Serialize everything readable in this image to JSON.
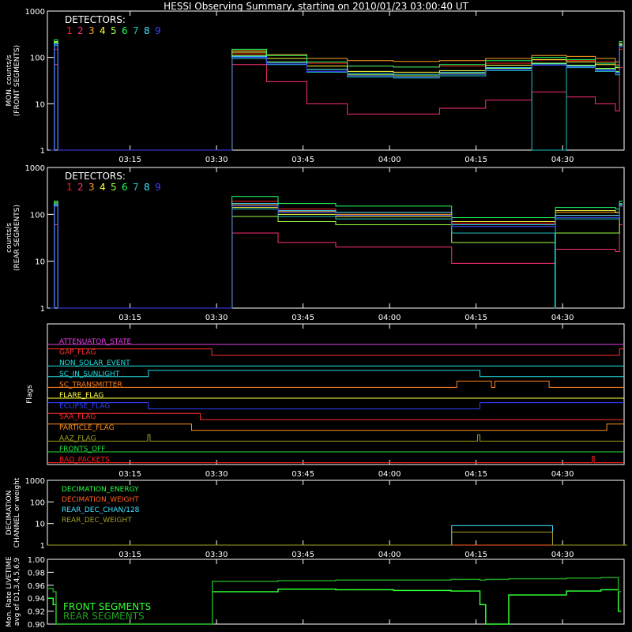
{
  "title": "HESSI Observing Summary, starting on 2010/01/23 03:00:40 UT",
  "colors": {
    "frame": "#ffffff",
    "det": [
      "#ff2020",
      "#ff3070",
      "#ffa020",
      "#ffff40",
      "#a0ff40",
      "#20ff60",
      "#20c0c0",
      "#40e0ff",
      "#4040ff"
    ]
  },
  "chart_data": [
    {
      "type": "line",
      "id": "front",
      "ylabel_lines": [
        "MON. counts/s",
        "(FRONT SEGMENTS)"
      ],
      "yscale": "log",
      "ylim": [
        1,
        1000
      ],
      "yticks": [
        "1",
        "10",
        "100",
        "1000"
      ],
      "xticks": [
        "03:15",
        "03:30",
        "03:45",
        "04:00",
        "04:15",
        "04:30"
      ],
      "legend_title": "DETECTORS:",
      "legend_items": [
        "1",
        "2",
        "3",
        "4",
        "5",
        "6",
        "7",
        "8",
        "9"
      ],
      "x_minutes": [
        0.5,
        1.2,
        1.8,
        28.5,
        32,
        38,
        45,
        52,
        60,
        68,
        76,
        84,
        90,
        95,
        98.5,
        99.2
      ],
      "series": [
        {
          "values": [
            1,
            150,
            1,
            1,
            120,
            95,
            75,
            65,
            62,
            65,
            75,
            88,
            85,
            80,
            70,
            150
          ]
        },
        {
          "values": [
            1,
            70,
            1,
            1,
            70,
            30,
            10,
            6,
            6,
            8,
            12,
            18,
            14,
            10,
            7,
            60
          ]
        },
        {
          "values": [
            1,
            200,
            1,
            1,
            140,
            115,
            95,
            85,
            82,
            85,
            95,
            110,
            105,
            95,
            80,
            180
          ]
        },
        {
          "values": [
            1,
            220,
            1,
            1,
            130,
            95,
            65,
            50,
            48,
            52,
            68,
            90,
            80,
            70,
            60,
            200
          ]
        },
        {
          "values": [
            1,
            210,
            1,
            1,
            110,
            80,
            55,
            42,
            40,
            45,
            58,
            75,
            68,
            58,
            50,
            190
          ]
        },
        {
          "values": [
            1,
            240,
            1,
            1,
            150,
            110,
            80,
            65,
            62,
            70,
            85,
            100,
            90,
            75,
            65,
            220
          ]
        },
        {
          "values": [
            1,
            180,
            1,
            1,
            95,
            70,
            48,
            38,
            36,
            40,
            52,
            1,
            60,
            50,
            42,
            170
          ]
        },
        {
          "values": [
            1,
            200,
            1,
            1,
            105,
            78,
            55,
            45,
            43,
            48,
            60,
            72,
            65,
            55,
            48,
            185
          ]
        },
        {
          "values": [
            1,
            190,
            1,
            1,
            100,
            72,
            50,
            40,
            38,
            43,
            55,
            68,
            62,
            52,
            45,
            175
          ]
        }
      ]
    },
    {
      "type": "line",
      "id": "rear",
      "ylabel_lines": [
        "counts/s",
        "(REAR SEGMENTS)"
      ],
      "yscale": "log",
      "ylim": [
        1,
        1000
      ],
      "yticks": [
        "1",
        "10",
        "100",
        "1000"
      ],
      "xticks": [
        "03:15",
        "03:30",
        "03:45",
        "04:00",
        "04:15",
        "04:30"
      ],
      "legend_title": "DETECTORS:",
      "legend_items": [
        "1",
        "2",
        "3",
        "4",
        "5",
        "6",
        "7",
        "8",
        "9"
      ],
      "x_minutes": [
        0.5,
        1.2,
        1.8,
        28.5,
        32,
        40,
        50,
        70,
        70.1,
        88,
        88.1,
        98.5,
        99.2
      ],
      "series": [
        {
          "values": [
            1,
            150,
            1,
            1,
            190,
            130,
            110,
            110,
            65,
            65,
            95,
            95,
            150
          ]
        },
        {
          "values": [
            1,
            60,
            1,
            1,
            40,
            25,
            20,
            20,
            9,
            8,
            18,
            16,
            60
          ]
        },
        {
          "values": [
            1,
            180,
            1,
            1,
            160,
            115,
            100,
            100,
            70,
            65,
            110,
            110,
            170
          ]
        },
        {
          "values": [
            1,
            150,
            1,
            1,
            140,
            100,
            90,
            90,
            70,
            70,
            120,
            110,
            160
          ]
        },
        {
          "values": [
            1,
            160,
            1,
            1,
            90,
            70,
            60,
            60,
            25,
            25,
            40,
            40,
            150
          ]
        },
        {
          "values": [
            1,
            190,
            1,
            1,
            240,
            170,
            150,
            150,
            85,
            80,
            140,
            130,
            190
          ]
        },
        {
          "values": [
            1,
            170,
            1,
            1,
            130,
            90,
            80,
            80,
            40,
            1,
            80,
            80,
            170
          ]
        },
        {
          "values": [
            1,
            160,
            1,
            1,
            170,
            120,
            110,
            110,
            60,
            60,
            95,
            95,
            160
          ]
        },
        {
          "values": [
            1,
            150,
            1,
            1,
            150,
            110,
            95,
            95,
            55,
            55,
            85,
            85,
            150
          ]
        }
      ]
    },
    {
      "type": "flags",
      "id": "flags",
      "ylabel": "Flags",
      "xticks": [
        "03:15",
        "03:30",
        "03:45",
        "04:00",
        "04:15",
        "04:30"
      ],
      "flags": [
        {
          "label": "ATTENUATOR_STATE",
          "color": "#e040e0",
          "segments": [
            [
              0,
              100,
              0
            ]
          ]
        },
        {
          "label": "GAP_FLAG",
          "color": "#ff3030",
          "segments": [
            [
              0,
              28.5,
              1
            ],
            [
              28.5,
              99.2,
              0
            ],
            [
              99.2,
              100,
              1
            ]
          ]
        },
        {
          "label": "NON_SOLAR_EVENT",
          "color": "#20e0e0",
          "segments": [
            [
              0,
              100,
              0
            ]
          ]
        },
        {
          "label": "SC_IN_SUNLIGHT",
          "color": "#20e0e0",
          "segments": [
            [
              0,
              17.5,
              0
            ],
            [
              17.5,
              75,
              1
            ],
            [
              75,
              100,
              0
            ]
          ]
        },
        {
          "label": "SC_TRANSMITTER",
          "color": "#ff8020",
          "segments": [
            [
              0,
              71,
              0
            ],
            [
              71,
              77,
              1
            ],
            [
              77,
              77.6,
              0
            ],
            [
              77.6,
              87,
              1
            ],
            [
              87,
              100,
              0
            ]
          ]
        },
        {
          "label": "FLARE_FLAG",
          "color": "#ffff40",
          "segments": [
            [
              0,
              100,
              0
            ]
          ]
        },
        {
          "label": "ECLIPSE_FLAG",
          "color": "#3040ff",
          "segments": [
            [
              0,
              17.5,
              1
            ],
            [
              17.5,
              75,
              0
            ],
            [
              75,
              100,
              1
            ]
          ]
        },
        {
          "label": "SAA_FLAG",
          "color": "#ff3030",
          "segments": [
            [
              0,
              26.5,
              1
            ],
            [
              26.5,
              100,
              0
            ]
          ]
        },
        {
          "label": "PARTICLE_FLAG",
          "color": "#ff9020",
          "segments": [
            [
              0,
              25,
              1
            ],
            [
              25,
              97,
              0
            ],
            [
              97,
              100,
              1
            ]
          ]
        },
        {
          "label": "AAZ_FLAG",
          "color": "#a0a020",
          "segments": [
            [
              0,
              17.4,
              0
            ],
            [
              17.4,
              17.8,
              1
            ],
            [
              17.8,
              74.6,
              0
            ],
            [
              74.6,
              75,
              1
            ],
            [
              75,
              100,
              0
            ]
          ]
        },
        {
          "label": "FRONTS_OFF",
          "color": "#20e040",
          "segments": [
            [
              0,
              100,
              0
            ]
          ]
        },
        {
          "label": "BAD_PACKETS",
          "color": "#ff2020",
          "segments": [
            [
              0,
              94.5,
              0
            ],
            [
              94.5,
              94.8,
              1
            ],
            [
              94.8,
              100,
              0
            ]
          ]
        }
      ]
    },
    {
      "type": "line",
      "id": "decimation",
      "ylabel_lines": [
        "DECIMATION",
        "CHANNEL or weight"
      ],
      "yscale": "log",
      "ylim": [
        1,
        1000
      ],
      "yticks": [
        "1",
        "10",
        "100",
        "1000"
      ],
      "xticks": [
        "03:15",
        "03:30",
        "03:45",
        "04:00",
        "04:15",
        "04:30"
      ],
      "legend_items": [
        "DECIMATION_ENERGY",
        "DECIMATION_WEIGHT",
        "REAR_DEC_CHAN/128",
        "REAR_DEC_WEIGHT"
      ],
      "legend_colors": [
        "#20ff40",
        "#ff6020",
        "#40e0ff",
        "#a0a020"
      ],
      "x_minutes": [
        0,
        70,
        70.1,
        87.5,
        87.6,
        100
      ],
      "series": [
        {
          "values": [
            1,
            1,
            1,
            1,
            1,
            1
          ]
        },
        {
          "values": [
            1,
            1,
            1,
            1,
            1,
            1
          ]
        },
        {
          "values": [
            1,
            1,
            8,
            8,
            1,
            1
          ]
        },
        {
          "values": [
            1,
            1,
            4,
            4,
            1,
            1
          ]
        }
      ]
    },
    {
      "type": "line",
      "id": "livetime",
      "ylabel_lines": [
        "Mon. Rate LIVETIME",
        "avg of D1,3,4,5,6,9"
      ],
      "ylim": [
        0.9,
        1.0
      ],
      "yticks": [
        "0.90",
        "0.92",
        "0.94",
        "0.96",
        "0.98",
        "1.00"
      ],
      "legend_items": [
        "FRONT SEGMENTS",
        "REAR SEGMENTS"
      ],
      "legend_colors": [
        "#30ff30",
        "#20a020"
      ],
      "x_minutes": [
        0,
        1,
        1.5,
        28.5,
        28.6,
        40,
        50,
        60,
        70,
        75,
        76,
        79,
        80,
        90,
        96,
        99
      ],
      "series": [
        {
          "values": [
            0.94,
            0.93,
            0.9,
            0.9,
            0.95,
            0.954,
            0.953,
            0.952,
            0.951,
            0.93,
            0.9,
            0.9,
            0.945,
            0.951,
            0.953,
            0.92
          ]
        },
        {
          "values": [
            0.955,
            0.95,
            0.9,
            0.9,
            0.966,
            0.967,
            0.968,
            0.968,
            0.969,
            0.968,
            0.969,
            0.969,
            0.97,
            0.971,
            0.972,
            0.95
          ]
        }
      ]
    }
  ]
}
